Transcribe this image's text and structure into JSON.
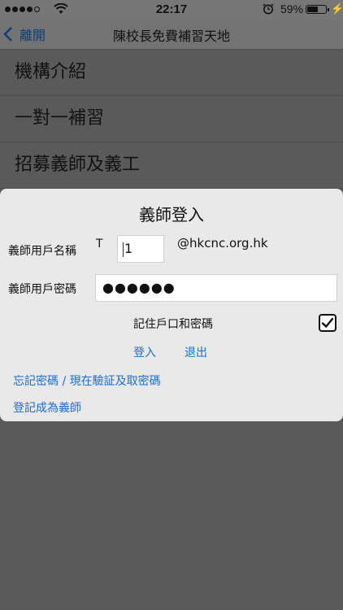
{
  "status_bar": {
    "time": "22:17",
    "battery_percent": "59%",
    "battery_level": 0.59,
    "signal_bars_filled": 4,
    "signal_bars_total": 5
  },
  "nav": {
    "back_label": "離開",
    "title": "陳校長免費補習天地"
  },
  "menu": {
    "items": [
      {
        "label": "機構介紹"
      },
      {
        "label": "一對一補習"
      },
      {
        "label": "招募義師及義工"
      }
    ]
  },
  "login_dialog": {
    "title": "義師登入",
    "username_label": "義師用戶名稱",
    "username_prefix": "T",
    "username_value": "1",
    "domain_suffix": "@hkcnc.org.hk",
    "password_label": "義師用戶密碼",
    "password_masked": "●●●●●●",
    "remember_label": "記住戶口和密碼",
    "remember_checked": true,
    "login_button": "登入",
    "exit_button": "退出",
    "forgot_link": "忘記密碼 / 現在驗証及取密碼",
    "register_link": "登記成為義師"
  },
  "colors": {
    "link": "#1a6ed8",
    "dim_overlay": "#5a5a5a",
    "dialog_bg": "#e9e9e9"
  }
}
